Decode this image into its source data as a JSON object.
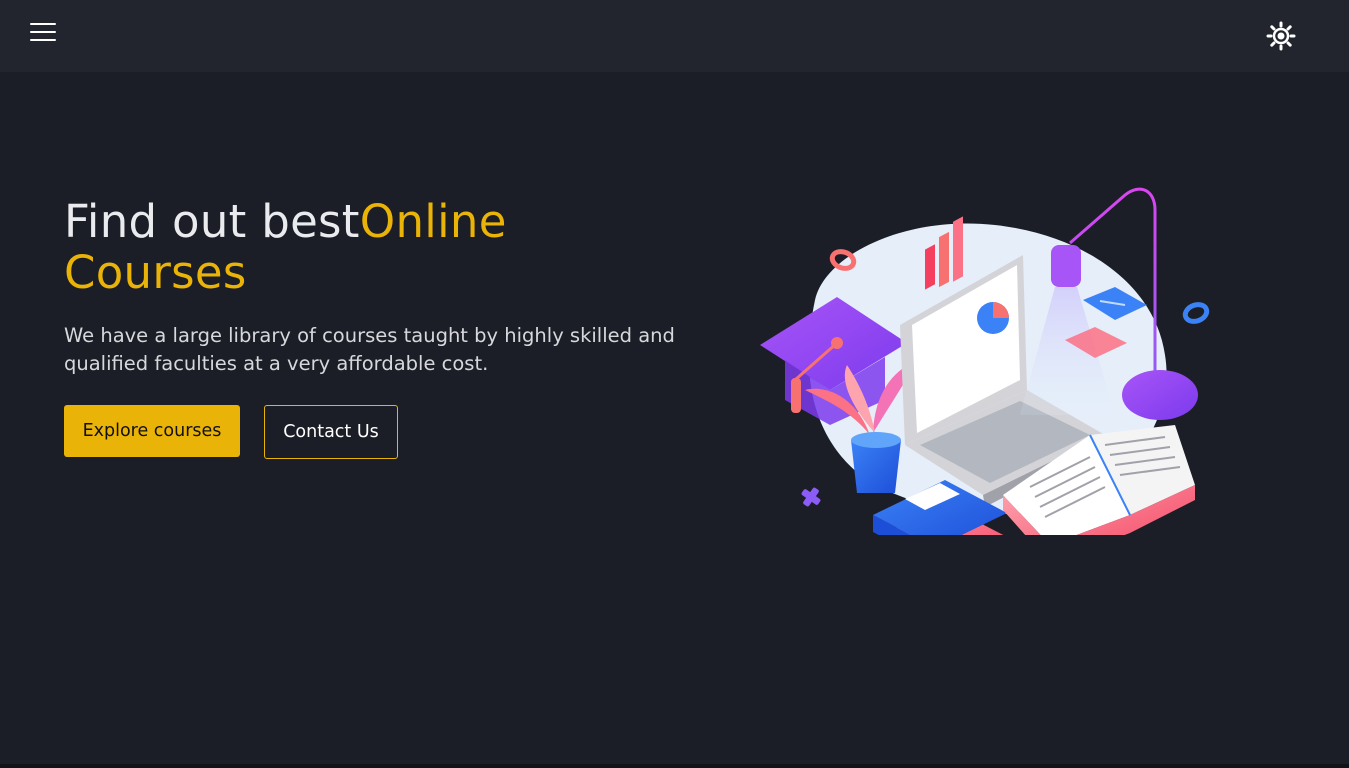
{
  "header": {
    "menu_icon": "hamburger-menu-icon",
    "theme_icon": "sun-icon"
  },
  "hero": {
    "title_part1": "Find out best",
    "title_accent": "Online Courses",
    "description": "We have a large library of courses taught by highly skilled and qualified faculties at a very affordable cost.",
    "primary_button": "Explore courses",
    "secondary_button": "Contact Us",
    "illustration": "online-education-isometric-illustration"
  },
  "colors": {
    "background": "#1b1e26",
    "header_background": "#22252d",
    "accent": "#eab308",
    "text": "#e9ebee"
  }
}
